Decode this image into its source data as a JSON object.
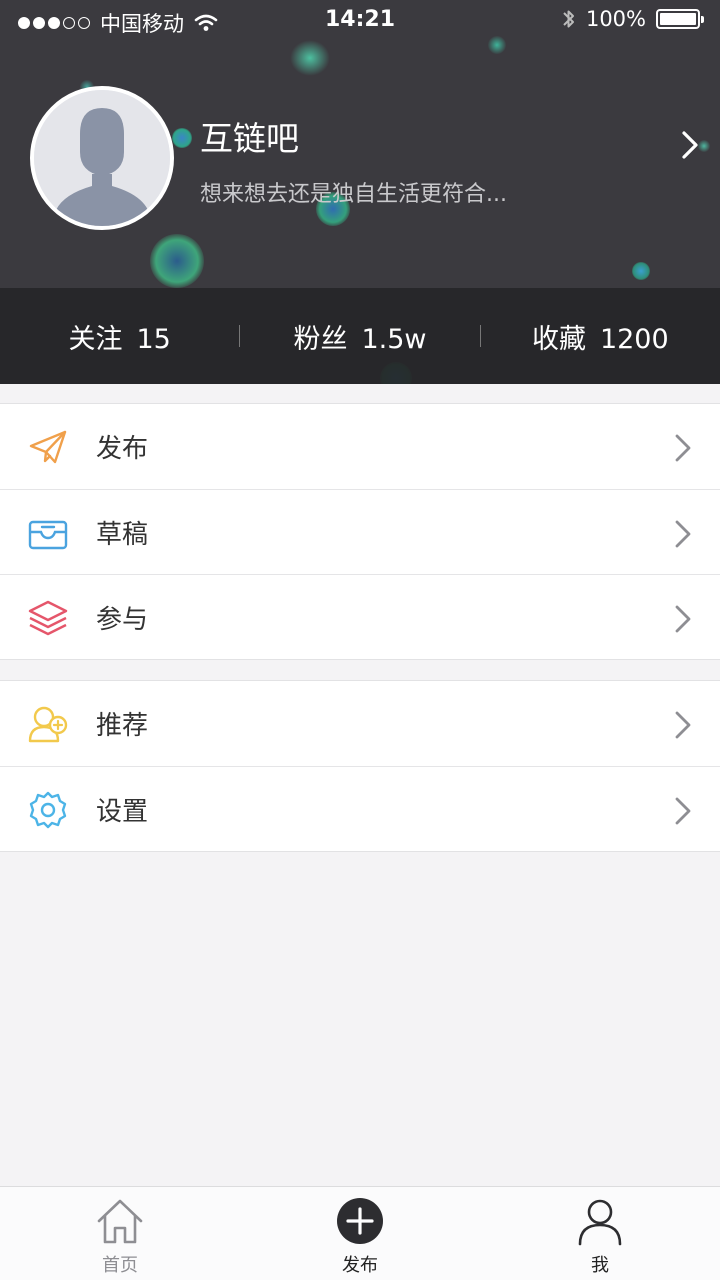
{
  "status_bar": {
    "carrier": "中国移动",
    "time": "14:21",
    "battery": "100%"
  },
  "profile": {
    "name": "互链吧",
    "bio": "想来想去还是独自生活更符合..."
  },
  "stats": [
    {
      "label": "关注",
      "value": "15"
    },
    {
      "label": "粉丝",
      "value": "1.5w"
    },
    {
      "label": "收藏",
      "value": "1200"
    }
  ],
  "menu": {
    "group1": [
      {
        "label": "发布",
        "icon": "paper-plane-icon",
        "color": "#f0a04b"
      },
      {
        "label": "草稿",
        "icon": "inbox-tray-icon",
        "color": "#4aa3df"
      },
      {
        "label": "参与",
        "icon": "layers-icon",
        "color": "#e5566b"
      }
    ],
    "group2": [
      {
        "label": "推荐",
        "icon": "add-friend-icon",
        "color": "#f2c94c"
      },
      {
        "label": "设置",
        "icon": "gear-icon",
        "color": "#4cb4e7"
      }
    ]
  },
  "tabbar": {
    "home": "首页",
    "publish": "发布",
    "me": "我"
  },
  "colors": {
    "header_bg": "#3b3a3f",
    "stats_bg": "#262628",
    "page_bg": "#f4f3f5"
  }
}
